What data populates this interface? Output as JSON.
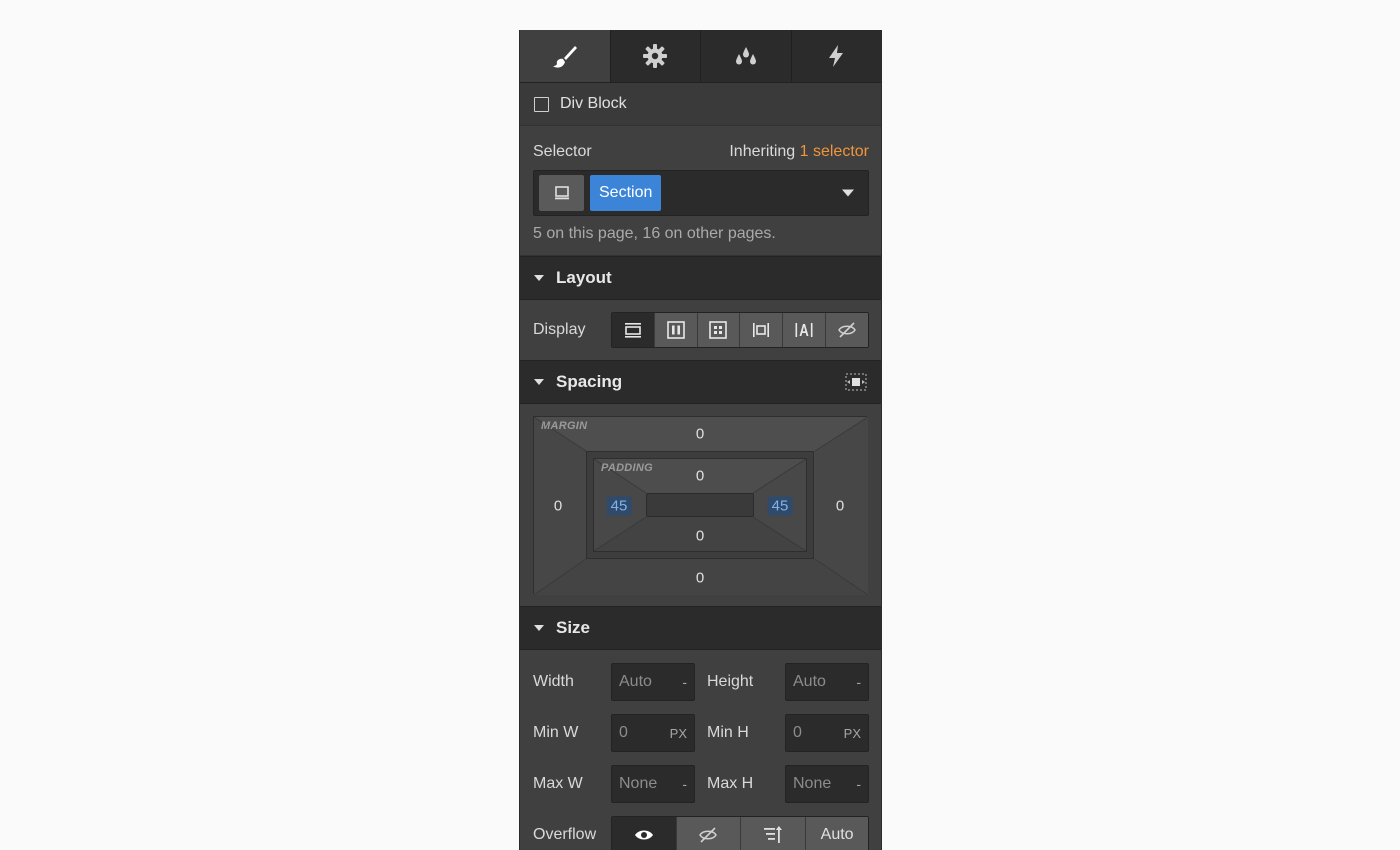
{
  "tabs": [
    {
      "icon": "paintbrush-icon",
      "active": true
    },
    {
      "icon": "gear-icon",
      "active": false
    },
    {
      "icon": "droplets-icon",
      "active": false
    },
    {
      "icon": "lightning-icon",
      "active": false
    }
  ],
  "element": {
    "label": "Div Block"
  },
  "selector": {
    "label": "Selector",
    "inheriting_text": "Inheriting",
    "inheriting_link": "1 selector",
    "class_tag": "Section",
    "note": "5 on this page, 16 on other pages."
  },
  "layout": {
    "title": "Layout",
    "display_label": "Display",
    "display_options": [
      "block-icon",
      "flex-icon",
      "grid-icon",
      "inline-block-icon",
      "inline-icon",
      "none-icon"
    ]
  },
  "spacing": {
    "title": "Spacing",
    "margin_label": "MARGIN",
    "padding_label": "PADDING",
    "margin": {
      "top": "0",
      "right": "0",
      "bottom": "0",
      "left": "0"
    },
    "padding": {
      "top": "0",
      "right": "45",
      "bottom": "0",
      "left": "45"
    }
  },
  "size": {
    "title": "Size",
    "rows": [
      {
        "l1": "Width",
        "v1": "Auto",
        "u1": "-",
        "l2": "Height",
        "v2": "Auto",
        "u2": "-"
      },
      {
        "l1": "Min W",
        "v1": "0",
        "u1": "PX",
        "l2": "Min H",
        "v2": "0",
        "u2": "PX"
      },
      {
        "l1": "Max W",
        "v1": "None",
        "u1": "-",
        "l2": "Max H",
        "v2": "None",
        "u2": "-"
      }
    ]
  },
  "overflow": {
    "label": "Overflow",
    "auto_label": "Auto"
  },
  "colors": {
    "panel_bg": "#404040",
    "header_bg": "#2b2b2b",
    "accent_blue": "#3b84d8",
    "accent_orange": "#f0953a"
  }
}
